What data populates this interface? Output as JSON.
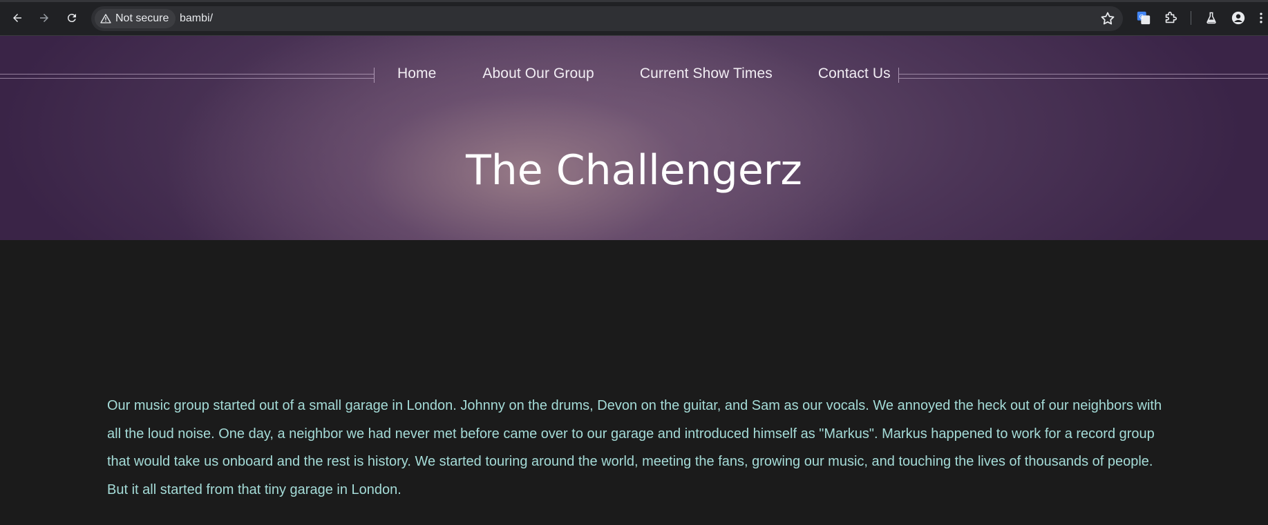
{
  "browser": {
    "security_label": "Not secure",
    "url": "bambi/",
    "icons": {
      "back": "arrow-left-icon",
      "forward": "arrow-right-icon",
      "reload": "reload-icon",
      "warning": "warning-triangle-icon",
      "bookmark": "star-icon",
      "translate": "translate-icon",
      "extensions": "puzzle-icon",
      "labs": "flask-icon",
      "profile": "person-icon",
      "menu": "kebab-menu-icon"
    }
  },
  "site": {
    "nav": [
      {
        "label": "Home"
      },
      {
        "label": "About Our Group"
      },
      {
        "label": "Current Show Times"
      },
      {
        "label": "Contact Us"
      }
    ],
    "title": "The Challengerz",
    "body_text": "Our music group started out of a small garage in London. Johnny on the drums, Devon on the guitar, and Sam as our vocals. We annoyed the heck out of our neighbors with all the loud noise. One day, a neighbor we had never met before came over to our garage and introduced himself as \"Markus\". Markus happened to work for a record group that would take us onboard and the rest is history. We started touring around the world, meeting the fans, growing our music, and touching the lives of thousands of people. But it all started from that tiny garage in London."
  },
  "colors": {
    "page_background": "#1b1b1b",
    "body_text": "#a5dcd8",
    "hero_purple": "#4d3658",
    "title": "#ffffff"
  }
}
